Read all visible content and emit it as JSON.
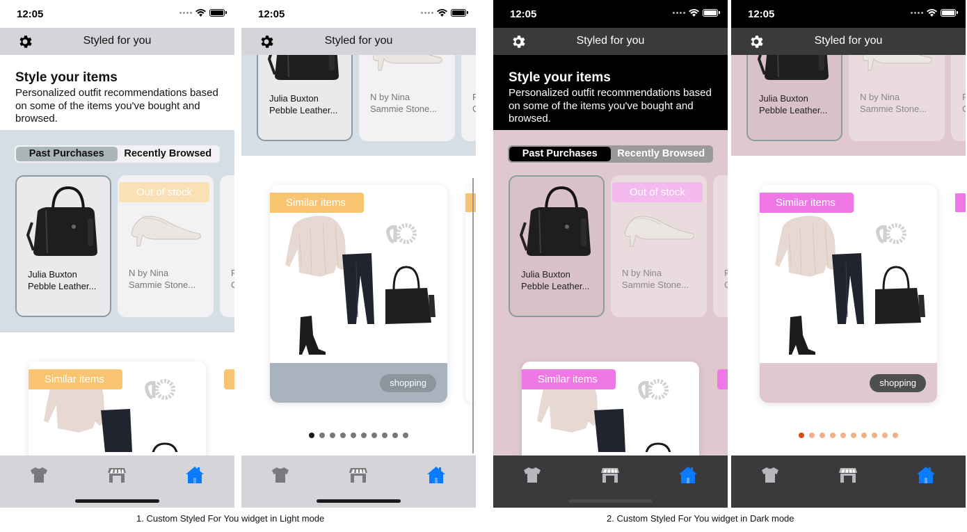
{
  "status": {
    "time": "12:05"
  },
  "nav": {
    "title": "Styled for you"
  },
  "header": {
    "title": "Style your items",
    "subtitle": "Personalized outfit recommendations based on some of the items you've bought and browsed."
  },
  "segment": {
    "past": "Past Purchases",
    "recent": "Recently Browsed"
  },
  "cards": [
    {
      "line1": "Julia Buxton",
      "line2": "Pebble Leather..."
    },
    {
      "line1": "N by Nina",
      "line2": "Sammie Stone...",
      "badge": "Out of stock"
    },
    {
      "line1": "F",
      "line2": "C"
    }
  ],
  "outfit": {
    "badge": "Similar items",
    "tag": "shopping"
  },
  "pagination": {
    "count": 10,
    "active": 0
  },
  "captions": {
    "light": "1. Custom Styled For You widget in Light mode",
    "dark": "2. Custom Styled For You widget in Dark mode"
  },
  "colors": {
    "light_band": "#d6dee5",
    "light_accent": "#f9c46f",
    "dark_accent": "#ef78e6",
    "dark_band": "#dfc9cf",
    "nav_light": "#d5d4d9",
    "nav_dark": "#3a3a3c",
    "tab_active": "#0a7aff"
  },
  "icons": {
    "settings": "gear-icon",
    "tab1": "tshirt-icon",
    "tab2": "storefront-icon",
    "tab3": "home-icon"
  }
}
